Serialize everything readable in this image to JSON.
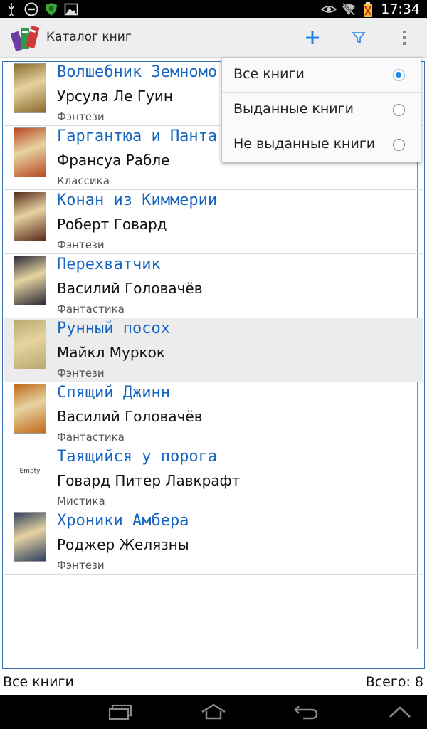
{
  "status_bar": {
    "time": "17:34",
    "icons": [
      "usb-icon",
      "dnd-icon",
      "shield-icon",
      "image-icon",
      "eye-icon",
      "wifi-off-icon",
      "battery-icon"
    ]
  },
  "action_bar": {
    "title": "Каталог книг",
    "add_icon": "plus-icon",
    "filter_icon": "filter-icon",
    "overflow_icon": "overflow-menu-icon"
  },
  "books": [
    {
      "title": "Волшебник Земномо",
      "author": "Урсула Ле Гуин",
      "genre": "Фэнтези",
      "cover_color": "#8b6a2e",
      "selected": false
    },
    {
      "title": "Гаргантюа и Панта",
      "author": "Франсуа Рабле",
      "genre": "Классика",
      "cover_color": "#b84a26",
      "selected": false
    },
    {
      "title": "Конан из Киммерии",
      "author": "Роберт Говард",
      "genre": "Фэнтези",
      "cover_color": "#5a2a1c",
      "selected": false
    },
    {
      "title": "Перехватчик",
      "author": "Василий Головачёв",
      "genre": "Фантастика",
      "cover_color": "#2c2c38",
      "selected": false
    },
    {
      "title": "Рунный посох",
      "author": "Майкл Муркок",
      "genre": "Фэнтези",
      "cover_color": "#b9a96e",
      "selected": true
    },
    {
      "title": "Спящий Джинн",
      "author": "Василий Головачёв",
      "genre": "Фантастика",
      "cover_color": "#c06a1a",
      "selected": false
    },
    {
      "title": "Таящийся у порога",
      "author": "Говард Питер Лавкрафт",
      "genre": "Мистика",
      "cover_text": "Empty",
      "selected": false
    },
    {
      "title": "Хроники Амбера",
      "author": "Роджер Желязны",
      "genre": "Фэнтези",
      "cover_color": "#2f4060",
      "selected": false
    }
  ],
  "filter_menu": {
    "items": [
      {
        "label": "Все книги",
        "checked": true
      },
      {
        "label": "Выданные книги",
        "checked": false
      },
      {
        "label": "Не выданные книги",
        "checked": false
      }
    ]
  },
  "footer": {
    "filter_label": "Все книги",
    "total_label": "Всего: 8"
  },
  "nav_bar": {
    "icons": [
      "recent-apps-icon",
      "home-icon",
      "back-icon",
      "collapse-icon"
    ]
  },
  "colors": {
    "accent": "#1e88e5",
    "title_text": "#1565c0"
  }
}
